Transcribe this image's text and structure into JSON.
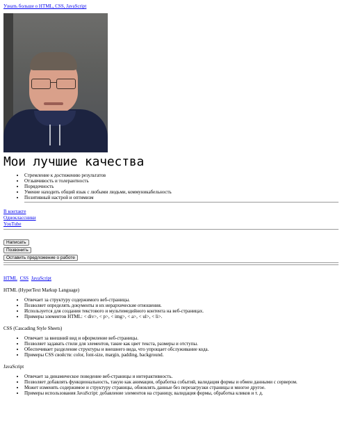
{
  "top_link": "Узнать больше о HTML, CSS, JavaScript",
  "photo_alt": "Фото",
  "heading": "Мои лучшие качества",
  "qualities": [
    "Стремление к достижению результатов",
    "Отзывчивость и толерантность",
    "Порядочность",
    "Умение находить общий язык с любыми людьми, коммуникабельность",
    "Позитивный настрой и оптимизм"
  ],
  "contacts": [
    "В контакте",
    "Одноклассники",
    "YouTube"
  ],
  "buttons": [
    "Написать",
    "Позвонить",
    "Оставить предложение о работе"
  ],
  "tabs": [
    "HTML",
    "CSS",
    "JavaScript"
  ],
  "sections": [
    {
      "title": "HTML (HyperText Markup Language)",
      "items": [
        "Отвечает за структуру содержимого веб-страницы.",
        "Позволяет определять документы и их иерархические отношения.",
        "Используется для создания текстового и мультимедийного контента на веб-страницах.",
        "Примеры элементов HTML: < div>, < p>, < img>, < a>, < ul>, < li>."
      ]
    },
    {
      "title": "CSS (Cascading Style Sheets)",
      "items": [
        "Отвечает за внешний вид и оформление веб-страницы.",
        "Позволяет задавать стили для элементов, такие как цвет текста, размеры и отступы.",
        "Обеспечивает разделение структуры и внешнего вида, что упрощает обслуживание кода.",
        "Примеры CSS свойств: color, font-size, margin, padding, background."
      ]
    },
    {
      "title": "JavaScript",
      "items": [
        "Отвечает за динамическое поведение веб-страницы и интерактивность.",
        "Позволяет добавлять функциональность, такую как анимации, обработка событий, валидация формы и обмен данными с сервером.",
        "Может изменять содержимое и структуру страницы, обновлять данные без перезагрузки страницы и многое другое.",
        "Примеры использования JavaScript: добавление элементов на страницу, валидация формы, обработка кликов и т. д."
      ]
    }
  ]
}
